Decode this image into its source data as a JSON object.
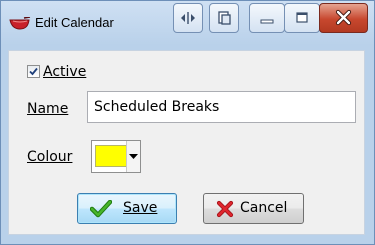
{
  "window": {
    "title": "Edit Calendar",
    "app_icon": "red-bowl-icon",
    "title_buttons": [
      "restore-arrows-icon",
      "copy-icon",
      "minimize-icon",
      "maximize-icon",
      "close-icon"
    ]
  },
  "form": {
    "active": {
      "label": "Active",
      "checked": true
    },
    "name": {
      "label": "Name",
      "value": "Scheduled Breaks"
    },
    "colour": {
      "label": "Colour",
      "value": "#ffff00"
    }
  },
  "buttons": {
    "save": {
      "label": "Save",
      "icon": "green-check-icon"
    },
    "cancel": {
      "label": "Cancel",
      "icon": "red-x-icon"
    }
  }
}
